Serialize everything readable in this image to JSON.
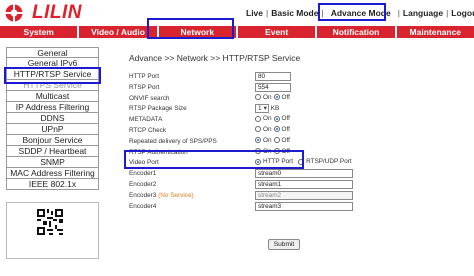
{
  "brand": {
    "logo_text": "LILIN",
    "accent": "#d9232e",
    "highlight": "#1d1bd0"
  },
  "topnav": {
    "live": "Live",
    "basic": "Basic Mode",
    "advance": "Advance Mode",
    "language": "Language",
    "logout": "Logout",
    "sep": "|"
  },
  "menu": [
    "System",
    "Video / Audio",
    "Network",
    "Event",
    "Notification",
    "Maintenance"
  ],
  "sidebar": [
    "General",
    "General IPv6",
    "HTTP/RTSP Service",
    "HTTPS Service",
    "Multicast",
    "IP Address Filtering",
    "DDNS",
    "UPnP",
    "Bonjour Service",
    "SDDP / Heartbeat",
    "SNMP",
    "MAC Address Filtering",
    "IEEE 802.1x"
  ],
  "breadcrumb": "Advance >> Network >> HTTP/RTSP Service",
  "form": {
    "http_port": {
      "label": "HTTP Port",
      "value": "80"
    },
    "rtsp_port": {
      "label": "RTSP Port",
      "value": "554"
    },
    "onvif": {
      "label": "ONVIF search",
      "on": "On",
      "off": "Off",
      "selected": "off"
    },
    "rtsp_package": {
      "label": "RTSP Package Size",
      "value": "1",
      "unit": "KB"
    },
    "metadata": {
      "label": "METADATA",
      "on": "On",
      "off": "Off",
      "selected": "off"
    },
    "rtcp": {
      "label": "RTCP Check",
      "on": "On",
      "off": "Off",
      "selected": "off"
    },
    "repeated": {
      "label": "Repeated delivery of SPS/PPS",
      "on": "On",
      "off": "Off",
      "selected": "on"
    },
    "rtsp_auth": {
      "label": "RTSP Authentication",
      "on": "On",
      "off": "Off",
      "selected": "on"
    },
    "video_port": {
      "label": "Video Port",
      "opt1": "HTTP Port",
      "opt2": "RTSP/UDP Port",
      "selected": "opt1"
    },
    "encoders": [
      {
        "label": "Encoder1",
        "note": "",
        "value": "stream0",
        "disabled": false
      },
      {
        "label": "Encoder2",
        "note": "",
        "value": "stream1",
        "disabled": false
      },
      {
        "label": "Encoder3",
        "note": "(No Service)",
        "value": "stream2",
        "disabled": true
      },
      {
        "label": "Encoder4",
        "note": "",
        "value": "stream3",
        "disabled": false
      }
    ],
    "submit": "Submit"
  }
}
